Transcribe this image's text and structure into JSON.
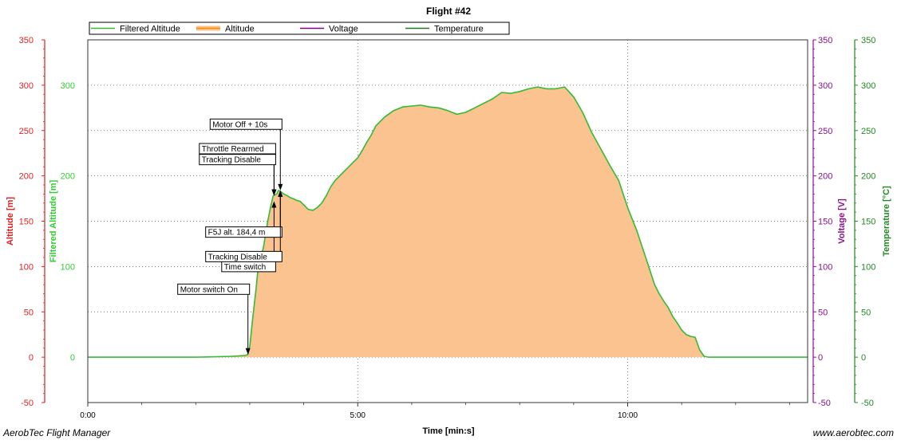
{
  "footer": {
    "app_name": "AerobTec Flight Manager",
    "website": "www.aerobtec.com"
  },
  "chart_data": {
    "type": "area",
    "title": "Flight #42",
    "xlabel": "Time [min:s]",
    "x_unit": "seconds",
    "xlim": [
      0,
      800
    ],
    "x_ticks": [
      {
        "value": 0,
        "label": "0:00"
      },
      {
        "value": 300,
        "label": "5:00"
      },
      {
        "value": 600,
        "label": "10:00"
      }
    ],
    "grid": true,
    "legend_position": "top",
    "legend": [
      {
        "label": "Filtered Altitude",
        "color": "#33bb33"
      },
      {
        "label": "Altitude",
        "color": "#ff8800"
      },
      {
        "label": "Voltage",
        "color": "#880088"
      },
      {
        "label": "Temperature",
        "color": "#227722"
      }
    ],
    "axes": [
      {
        "id": "altitude",
        "label": "Altitude [m]",
        "side": "left",
        "color": "#dd2222",
        "range": [
          -50,
          350
        ],
        "ticks": [
          -50,
          0,
          50,
          100,
          150,
          200,
          250,
          300,
          350
        ]
      },
      {
        "id": "filtered",
        "label": "Filtered Altitude [m]",
        "side": "left",
        "color": "#33cc33",
        "range": [
          -50,
          350
        ],
        "ticks": [
          0,
          100,
          200,
          300
        ]
      },
      {
        "id": "voltage",
        "label": "Voltage [V]",
        "side": "right",
        "color": "#881188",
        "range": [
          -50,
          350
        ],
        "ticks": [
          -50,
          0,
          50,
          100,
          150,
          200,
          250,
          300,
          350
        ]
      },
      {
        "id": "temperature",
        "label": "Temperature [°C]",
        "side": "right",
        "color": "#228822",
        "range": [
          -50,
          350
        ],
        "ticks": [
          -50,
          0,
          50,
          100,
          150,
          200,
          250,
          300,
          350
        ]
      }
    ],
    "series": [
      {
        "name": "Filtered Altitude",
        "color": "#33bb33",
        "fill": "#fbc38f",
        "x": [
          0,
          60,
          120,
          160,
          175,
          178,
          180,
          183,
          187,
          190,
          195,
          200,
          203,
          206,
          210,
          212,
          214,
          218,
          222,
          225,
          228,
          232,
          236,
          240,
          245,
          250,
          255,
          260,
          265,
          270,
          275,
          280,
          285,
          290,
          295,
          300,
          305,
          310,
          315,
          320,
          330,
          340,
          350,
          360,
          370,
          380,
          390,
          400,
          410,
          420,
          430,
          440,
          450,
          460,
          470,
          480,
          490,
          500,
          505,
          510,
          520,
          530,
          540,
          550,
          560,
          570,
          580,
          590,
          600,
          610,
          620,
          625,
          630,
          635,
          640,
          645,
          650,
          655,
          660,
          665,
          670,
          675,
          680,
          685,
          690,
          695,
          700,
          705,
          710,
          715,
          720,
          725,
          730,
          735,
          740,
          745,
          750,
          755,
          760,
          770,
          780,
          790,
          800
        ],
        "values": [
          0,
          0,
          0,
          1,
          2,
          3,
          12,
          40,
          75,
          105,
          120,
          150,
          165,
          178,
          180,
          184,
          183,
          180,
          178,
          176,
          175,
          173,
          172,
          168,
          163,
          162,
          165,
          170,
          178,
          188,
          195,
          200,
          205,
          210,
          215,
          220,
          228,
          237,
          245,
          255,
          265,
          272,
          276,
          277,
          278,
          276,
          275,
          272,
          268,
          270,
          275,
          280,
          285,
          292,
          291,
          293,
          296,
          298,
          297,
          296,
          296,
          298,
          287,
          270,
          248,
          230,
          212,
          195,
          165,
          140,
          110,
          95,
          80,
          70,
          62,
          55,
          45,
          38,
          30,
          25,
          23,
          22,
          8,
          1,
          0,
          0,
          0,
          0,
          0,
          0,
          0,
          0,
          0,
          0,
          0,
          0,
          0,
          0,
          0,
          0,
          0,
          0,
          0
        ]
      }
    ],
    "annotations": [
      {
        "label": "Motor switch On",
        "x": 178,
        "y": 3,
        "text_x": 178,
        "text_y": 75
      },
      {
        "label": "Time switch",
        "x": 207,
        "y": 172,
        "text_x": 207,
        "text_y": 100
      },
      {
        "label": "Throttle Rearmed",
        "x": 207,
        "y": 178,
        "text_x": 207,
        "text_y": 230
      },
      {
        "label": "Tracking Disable",
        "x": 207,
        "y": 178,
        "text_x": 207,
        "text_y": 218
      },
      {
        "label": "Motor Off + 10s",
        "x": 214,
        "y": 184,
        "text_x": 214,
        "text_y": 257
      },
      {
        "label": "F5J alt. 184,4 m",
        "x": 214,
        "y": 184,
        "text_x": 214,
        "text_y": 138
      },
      {
        "label": "Tracking Disable",
        "x": 214,
        "y": 184,
        "text_x": 214,
        "text_y": 111
      }
    ]
  }
}
